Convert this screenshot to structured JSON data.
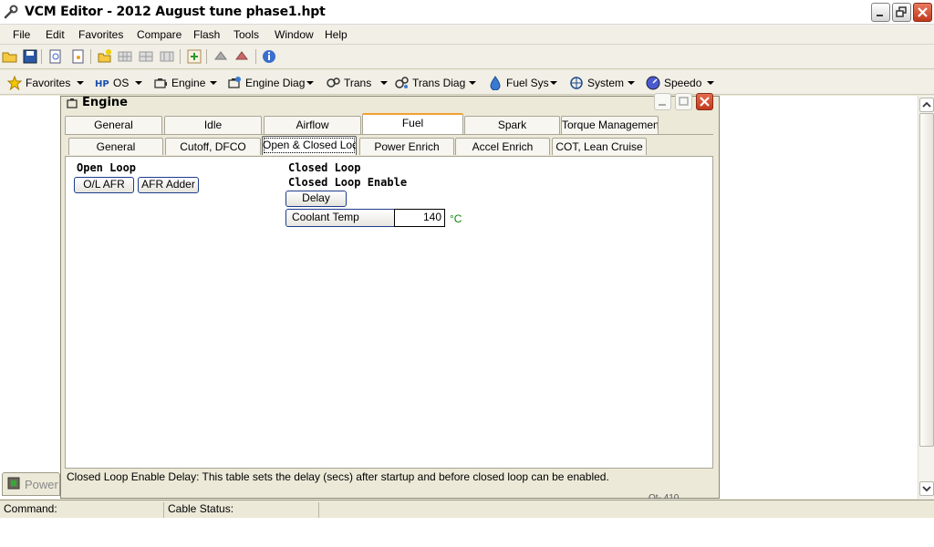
{
  "window": {
    "title": "VCM Editor - 2012 August tune phase1.hpt"
  },
  "menu": [
    "File",
    "Edit",
    "Favorites",
    "Compare",
    "Flash",
    "Tools",
    "Window",
    "Help"
  ],
  "nav": [
    {
      "label": "Favorites",
      "icon": "star-icon"
    },
    {
      "label": "OS",
      "icon": "hp-logo-icon"
    },
    {
      "label": "Engine",
      "icon": "engine-icon"
    },
    {
      "label": "Engine Diag",
      "icon": "engine-diag-icon"
    },
    {
      "label": "Trans",
      "icon": "transmission-icon"
    },
    {
      "label": "Trans Diag",
      "icon": "trans-diag-icon"
    },
    {
      "label": "Fuel Sys",
      "icon": "fuel-drop-icon"
    },
    {
      "label": "System",
      "icon": "system-icon"
    },
    {
      "label": "Speedo",
      "icon": "speedometer-icon"
    }
  ],
  "engine_window": {
    "title": "Engine",
    "main_tabs": [
      "General",
      "Idle",
      "Airflow",
      "Fuel",
      "Spark",
      "Torque Management"
    ],
    "main_active": "Fuel",
    "sub_tabs": [
      "General",
      "Cutoff, DFCO",
      "Open & Closed Loop",
      "Power Enrich",
      "Accel Enrich",
      "COT, Lean Cruise"
    ],
    "sub_active": "Open & Closed Loop",
    "open_loop": {
      "title": "Open Loop",
      "buttons": [
        "O/L AFR",
        "AFR Adder"
      ]
    },
    "closed_loop": {
      "title": "Closed Loop",
      "enable_title": "Closed Loop Enable",
      "delay_button": "Delay",
      "coolant_label": "Coolant Temp",
      "coolant_value": "140",
      "coolant_unit": "°C"
    },
    "description": "Closed Loop Enable Delay: This table sets the delay (secs) after startup and before closed loop can be enabled.",
    "description_cut": "Ot- 410"
  },
  "side_tab": {
    "label": "Power"
  },
  "status": {
    "command_label": "Command:",
    "cable_label": "Cable Status:"
  },
  "colors": {
    "accent_tab": "#f0a030",
    "unit_green": "#0a8a0a",
    "button_border": "#1e3c8c"
  }
}
